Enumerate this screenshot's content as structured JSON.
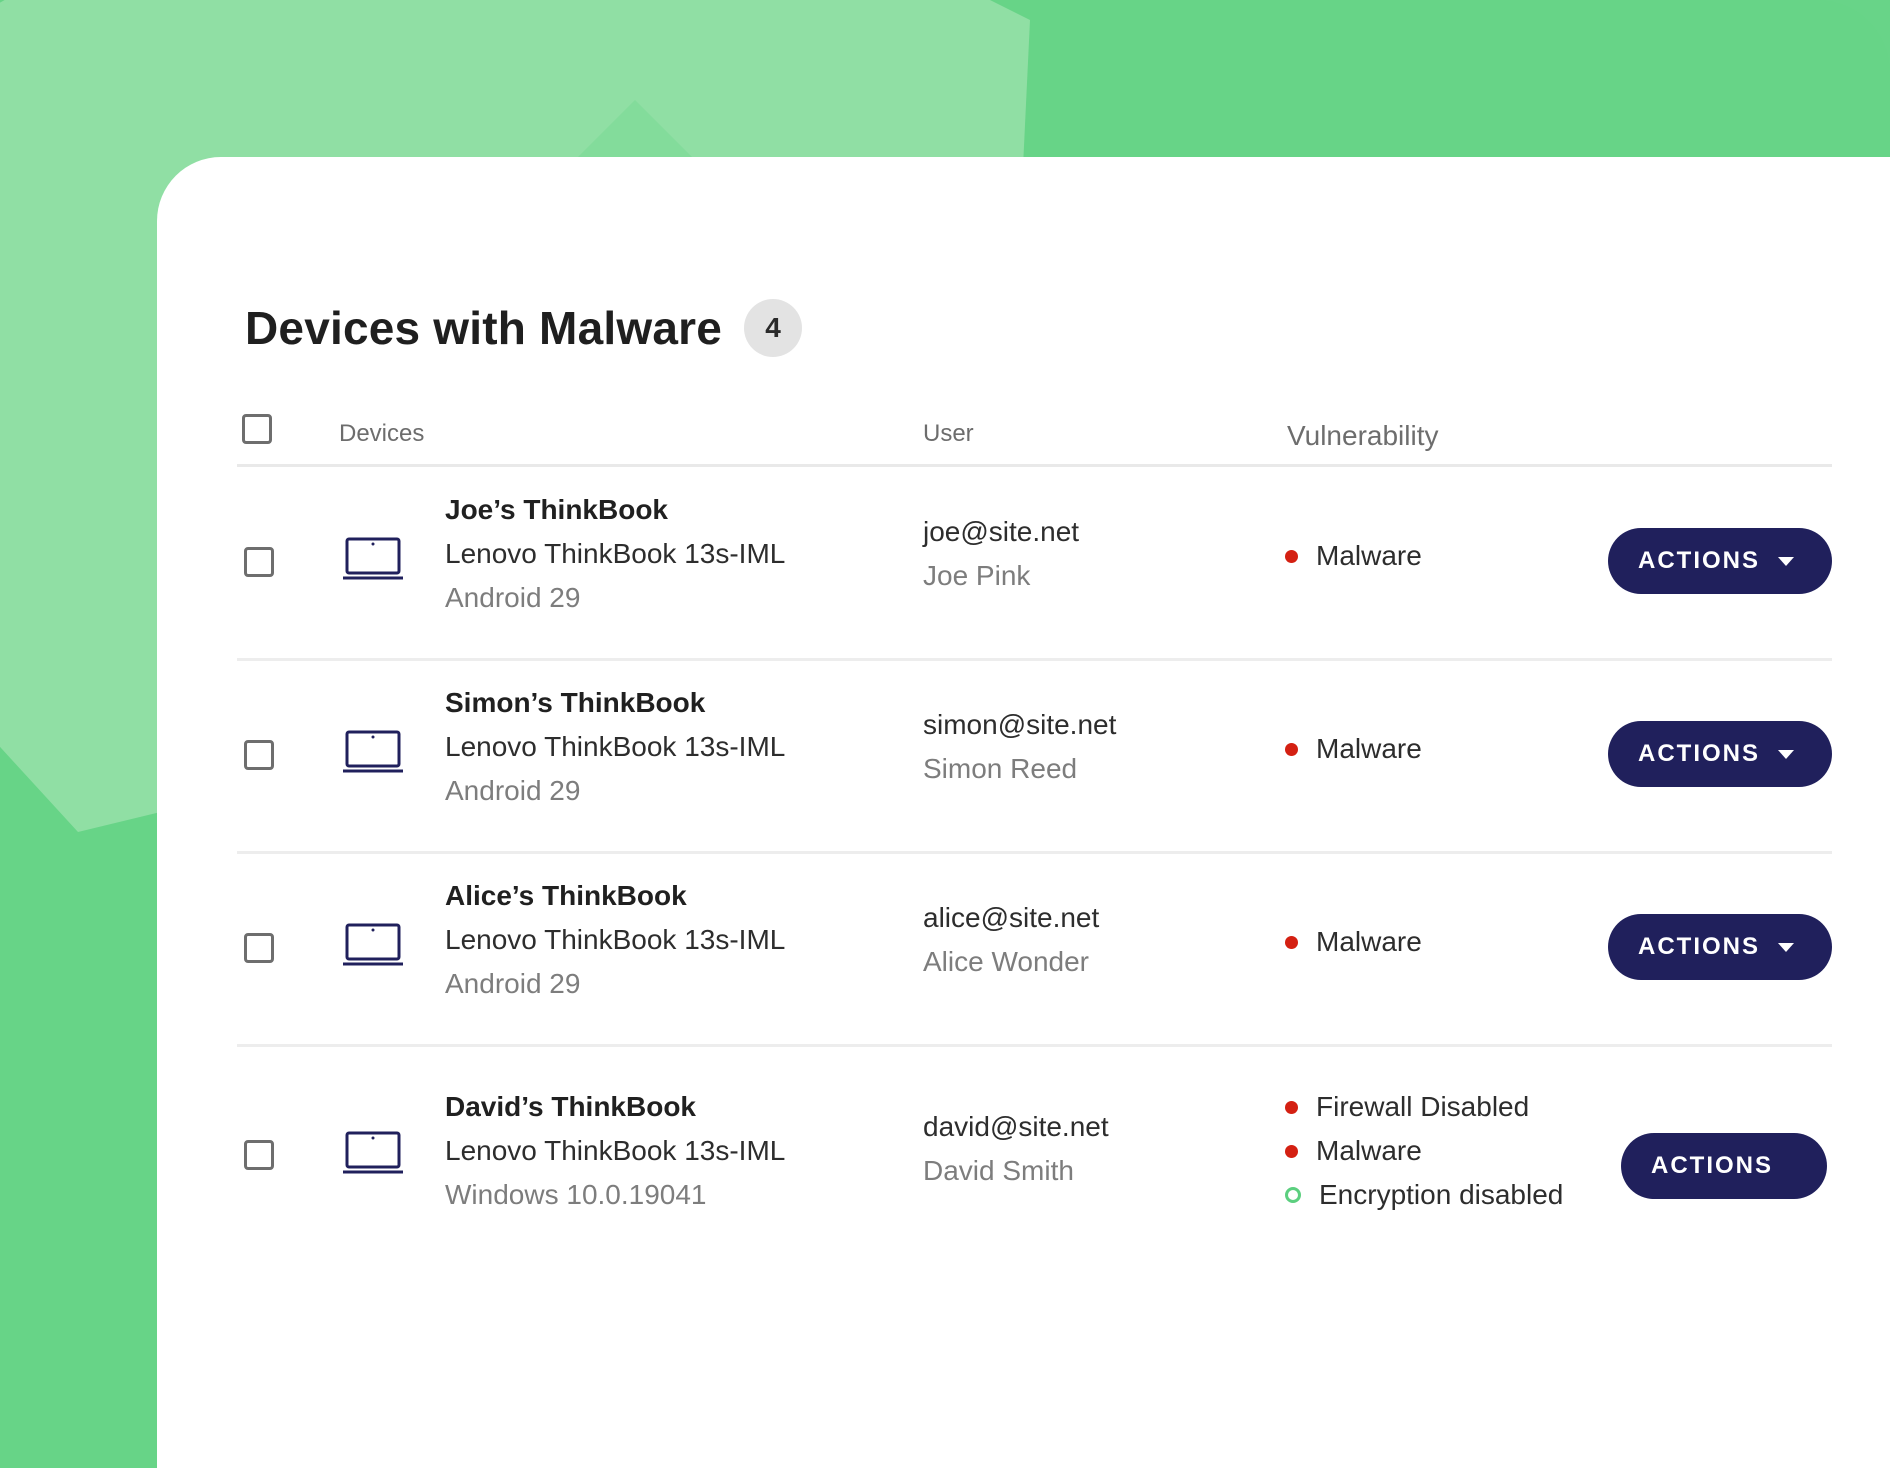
{
  "header": {
    "title": "Devices with Malware",
    "count": "4"
  },
  "table": {
    "columns": {
      "devices": "Devices",
      "user": "User",
      "vulnerability": "Vulnerability"
    },
    "rows": [
      {
        "device_name": "Joe’s ThinkBook",
        "model": "Lenovo ThinkBook 13s-IML",
        "os": "Android 29",
        "email": "joe@site.net",
        "user_name": "Joe Pink",
        "vulnerabilities": [
          {
            "label": "Malware",
            "status": "critical"
          }
        ],
        "action_label": "ACTIONS",
        "dropdown": true
      },
      {
        "device_name": "Simon’s ThinkBook",
        "model": "Lenovo ThinkBook 13s-IML",
        "os": "Android 29",
        "email": "simon@site.net",
        "user_name": "Simon Reed",
        "vulnerabilities": [
          {
            "label": "Malware",
            "status": "critical"
          }
        ],
        "action_label": "ACTIONS",
        "dropdown": true
      },
      {
        "device_name": "Alice’s ThinkBook",
        "model": "Lenovo ThinkBook 13s-IML",
        "os": "Android 29",
        "email": "alice@site.net",
        "user_name": "Alice Wonder",
        "vulnerabilities": [
          {
            "label": "Malware",
            "status": "critical"
          }
        ],
        "action_label": "ACTIONS",
        "dropdown": true
      },
      {
        "device_name": "David’s ThinkBook",
        "model": "Lenovo ThinkBook 13s-IML",
        "os": "Windows 10.0.19041",
        "email": "david@site.net",
        "user_name": "David Smith",
        "vulnerabilities": [
          {
            "label": "Firewall Disabled",
            "status": "critical"
          },
          {
            "label": "Malware",
            "status": "critical"
          },
          {
            "label": "Encryption disabled",
            "status": "warning"
          }
        ],
        "action_label": "ACTIONS",
        "dropdown": false
      }
    ]
  },
  "colors": {
    "background": "#68d488",
    "button": "#20205c",
    "critical": "#d42012",
    "warning": "#5ccf7f"
  },
  "icons": {
    "device": "laptop-icon",
    "dropdown": "chevron-down-icon"
  }
}
